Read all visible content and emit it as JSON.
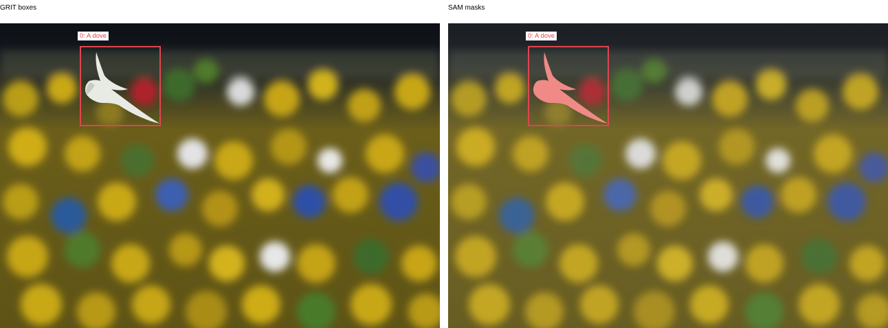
{
  "panels": [
    {
      "title": "GRIT boxes",
      "detections": [
        {
          "label": "0: A dove",
          "color": "#e04550"
        }
      ],
      "dove_style": "white"
    },
    {
      "title": "SAM masks",
      "detections": [
        {
          "label": "0: A dove",
          "color": "#e04550"
        }
      ],
      "mask_color": "#f08a86"
    }
  ],
  "scene": {
    "subject": "dove",
    "background": "blurred stadium crowd in yellow and green",
    "colors": {
      "dark_top": "#12151a",
      "crowd_yellow": "#b59b17",
      "crowd_green": "#3d5a24",
      "crowd_blue": "#2f4fa0"
    }
  }
}
